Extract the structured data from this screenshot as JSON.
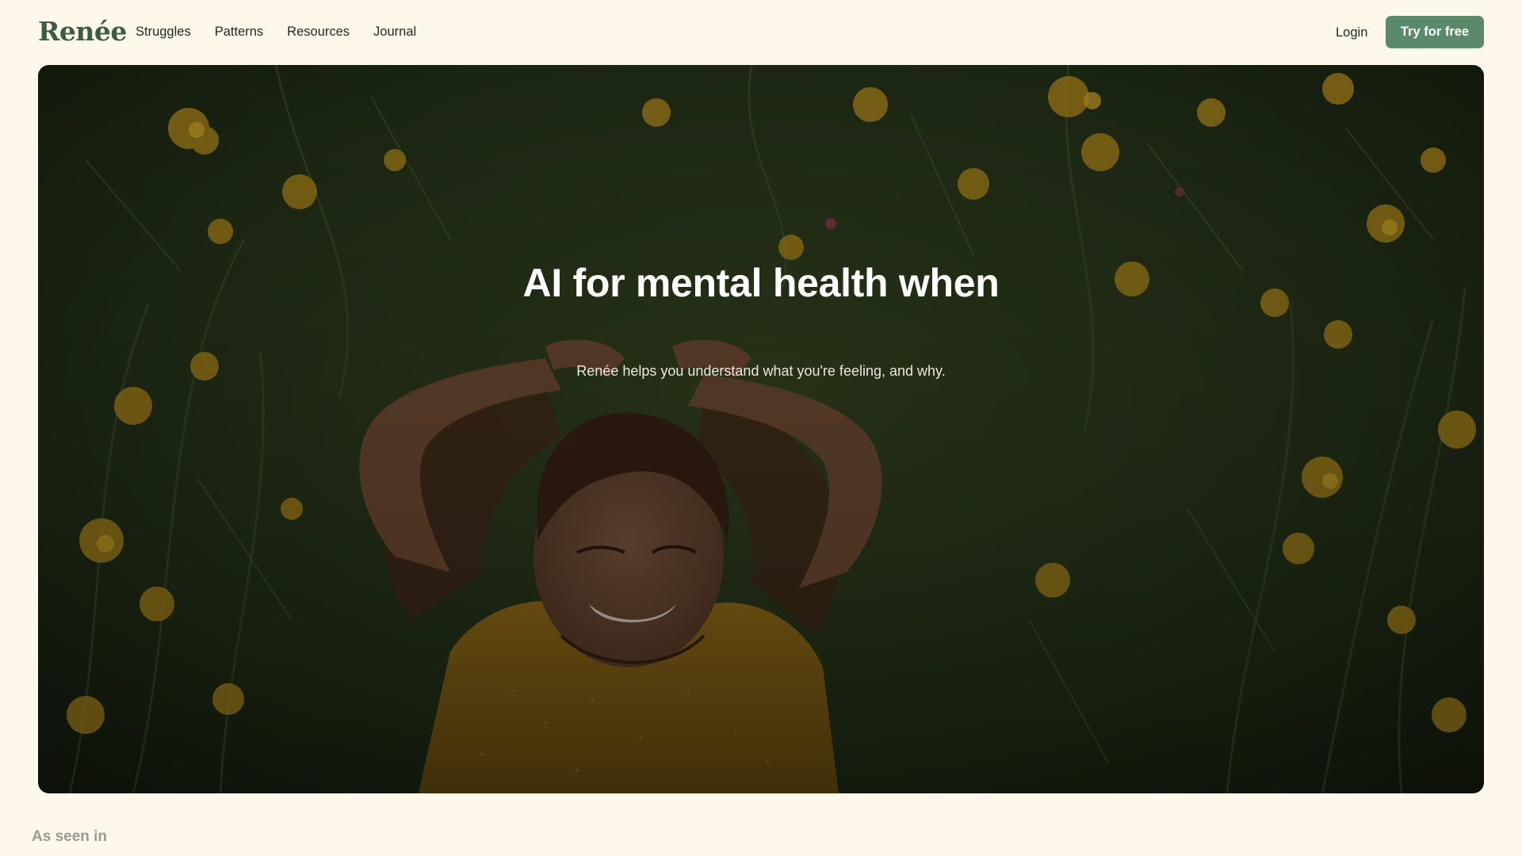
{
  "brand": {
    "logo_text": "Renée"
  },
  "nav": {
    "links": [
      {
        "label": "Struggles"
      },
      {
        "label": "Patterns"
      },
      {
        "label": "Resources"
      },
      {
        "label": "Journal"
      }
    ],
    "login_label": "Login",
    "cta_label": "Try for free"
  },
  "hero": {
    "title": "AI for mental health when",
    "subtitle": "Renée helps you understand what you're feeling, and why."
  },
  "press": {
    "heading": "As seen in"
  },
  "colors": {
    "page_bg": "#fdf8ea",
    "brand_green": "#3b5b45",
    "cta_green": "#5b8a6a",
    "flower_yellow": "#c89a1c"
  },
  "icons": {
    "hero_photo": "woman-lying-in-flower-meadow-photo"
  }
}
